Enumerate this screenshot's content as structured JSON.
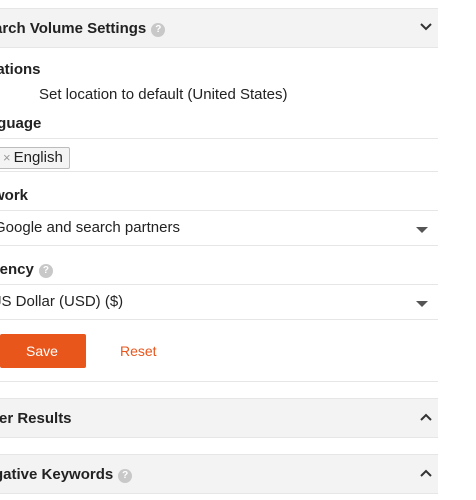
{
  "search_volume_settings": {
    "title": "arch Volume Settings",
    "help_icon": "question-icon",
    "chevron": "chevron-down-icon"
  },
  "locations": {
    "label": "cations",
    "value": "Set location to default (United States)"
  },
  "language": {
    "label": "nguage",
    "tag_remove": "×",
    "tag": "English"
  },
  "network": {
    "label": "twork",
    "selected": "Google and search partners",
    "selected_visible": "Google and search partners"
  },
  "currency": {
    "label": "rrency",
    "help_icon": "question-icon",
    "selected": "JS Dollar (USD) ($)"
  },
  "actions": {
    "save_label": "Save",
    "reset_label": "Reset"
  },
  "filter_results": {
    "title": "ter Results",
    "chevron": "chevron-up-icon"
  },
  "negative_keywords": {
    "title": "gative Keywords",
    "help_icon": "question-icon",
    "chevron": "chevron-up-icon"
  },
  "colors": {
    "accent": "#e8561c",
    "header_bg": "#f3f3f3",
    "border": "#e6e6e6",
    "text": "#222222"
  }
}
